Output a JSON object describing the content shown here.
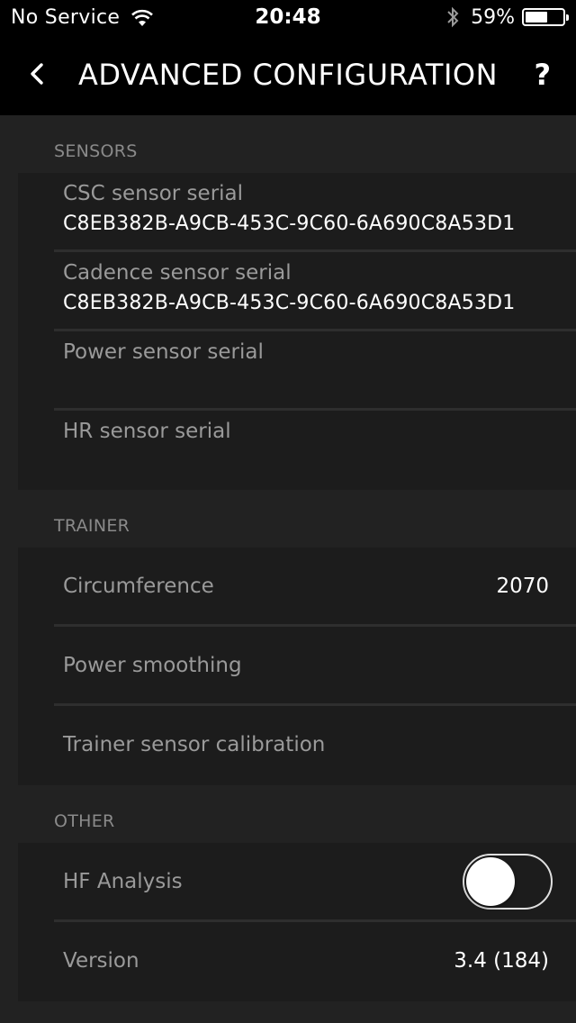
{
  "status_bar": {
    "carrier": "No Service",
    "time": "20:48",
    "battery_percent": "59%",
    "battery_level": 0.59,
    "icons": [
      "wifi-icon",
      "bluetooth-icon",
      "battery-icon"
    ]
  },
  "nav": {
    "title": "ADVANCED CONFIGURATION",
    "help": "?",
    "back_icon": "chevron-left-icon"
  },
  "sensors": {
    "header": "SENSORS",
    "rows": [
      {
        "label": "CSC sensor serial",
        "value": "C8EB382B-A9CB-453C-9C60-6A690C8A53D1"
      },
      {
        "label": "Cadence sensor serial",
        "value": "C8EB382B-A9CB-453C-9C60-6A690C8A53D1"
      },
      {
        "label": "Power sensor serial",
        "value": ""
      },
      {
        "label": "HR sensor serial",
        "value": ""
      }
    ]
  },
  "trainer": {
    "header": "TRAINER",
    "rows": [
      {
        "label": "Circumference",
        "value": "2070"
      },
      {
        "label": "Power smoothing",
        "value": ""
      },
      {
        "label": "Trainer sensor calibration",
        "value": ""
      }
    ]
  },
  "other": {
    "header": "OTHER",
    "hf_label": "HF Analysis",
    "hf_enabled": false,
    "version_label": "Version",
    "version_value": "3.4 (184)"
  },
  "colors": {
    "background": "#222222",
    "group": "#1c1c1c",
    "bar": "#000000",
    "label": "#9a9a9a",
    "section_label": "#8a8a8a"
  }
}
